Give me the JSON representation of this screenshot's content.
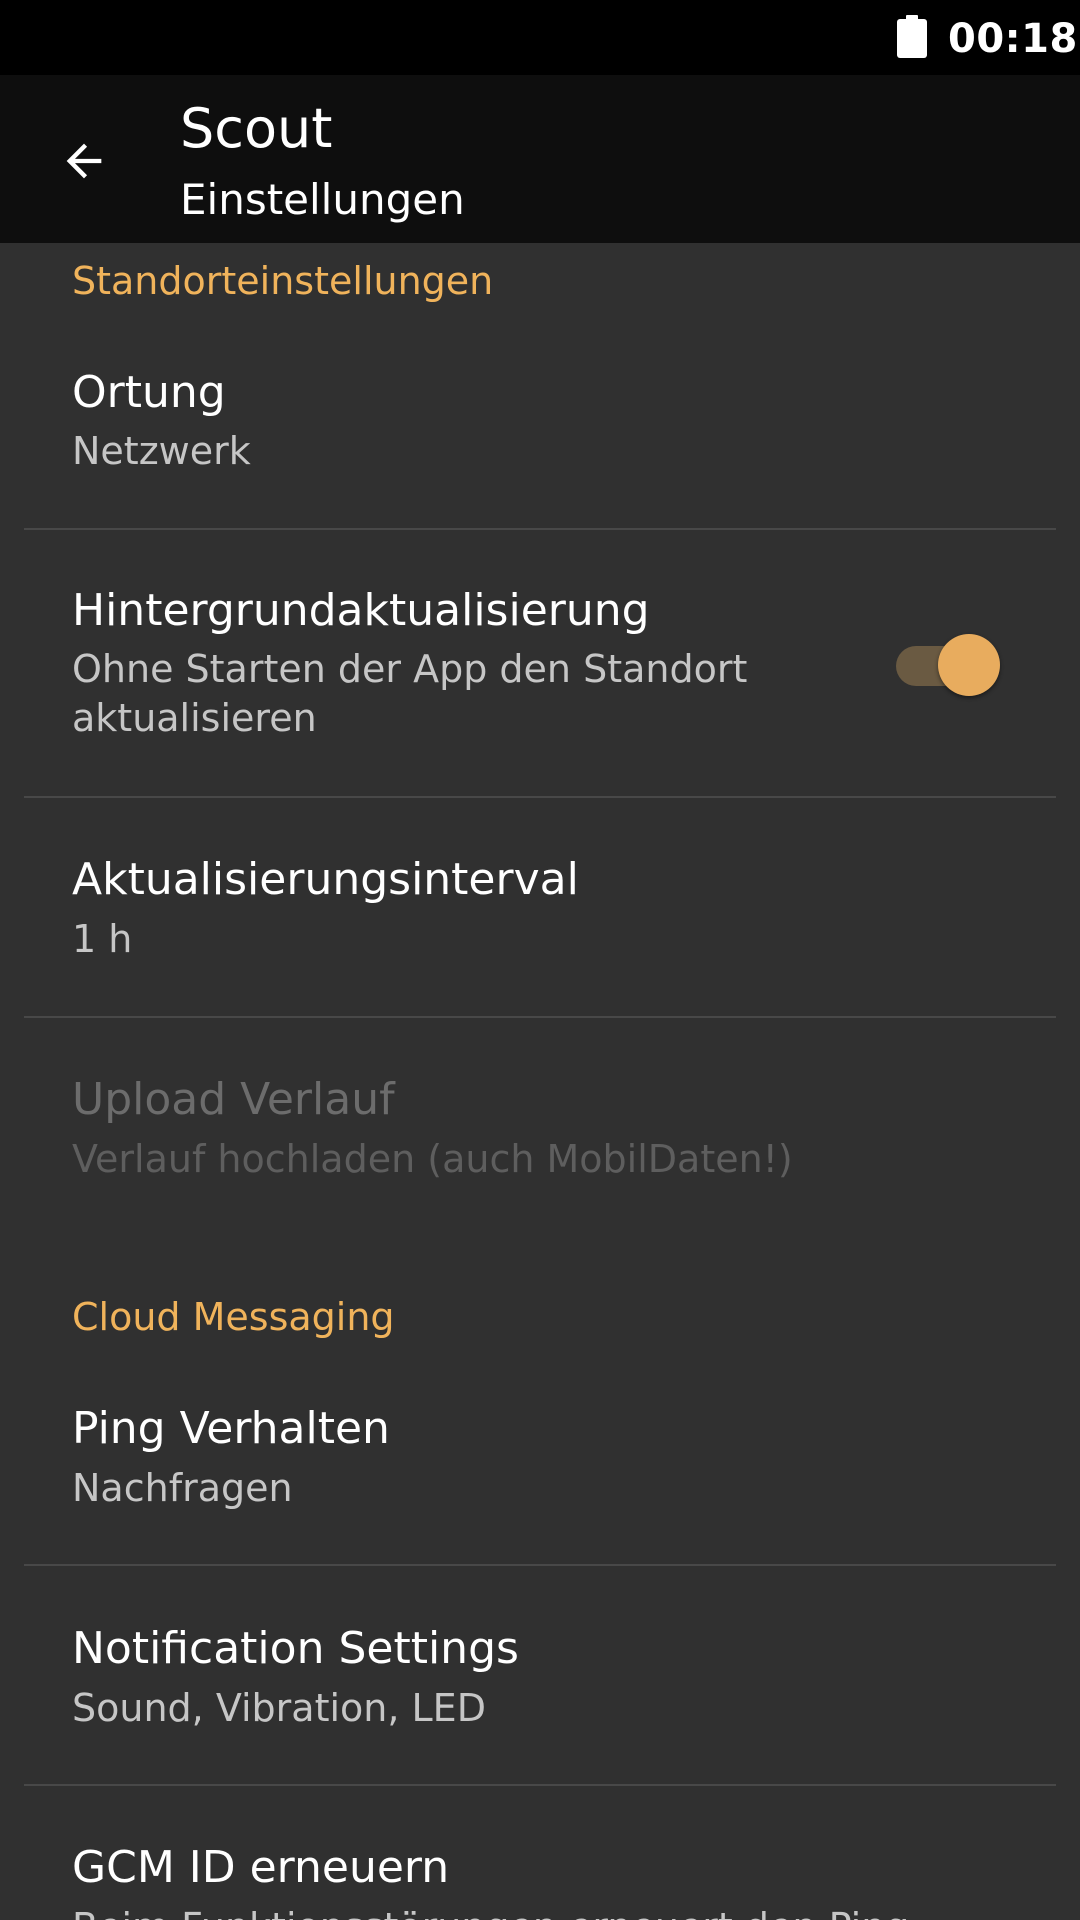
{
  "status_bar": {
    "time": "00:18",
    "battery_icon": "battery-full-icon"
  },
  "toolbar": {
    "back_icon": "arrow-back-icon",
    "title": "Scout",
    "subtitle": "Einstellungen"
  },
  "sections": [
    {
      "header": "Standorteinstellungen",
      "items": [
        {
          "title": "Ortung",
          "summary": "Netzwerk"
        },
        {
          "title": "Hintergrundaktualisierung",
          "summary": "Ohne Starten der App den Standort aktualisieren",
          "switch_on": true
        },
        {
          "title": "Aktualisierungsinterval",
          "summary": "1 h"
        },
        {
          "title": "Upload Verlauf",
          "summary": "Verlauf hochladen (auch MobilDaten!)",
          "enabled": false
        }
      ]
    },
    {
      "header": "Cloud Messaging",
      "items": [
        {
          "title": "Ping Verhalten",
          "summary": "Nachfragen"
        },
        {
          "title": "Notification Settings",
          "summary": "Sound, Vibration, LED"
        },
        {
          "title": "GCM ID erneuern",
          "summary": "Beim Funktionsstörungen erneuert den Ping"
        }
      ]
    }
  ],
  "colors": {
    "accent": "#f0b35b",
    "background": "#303030",
    "toolbar": "#0e0e0e",
    "status_bar": "#000000"
  }
}
